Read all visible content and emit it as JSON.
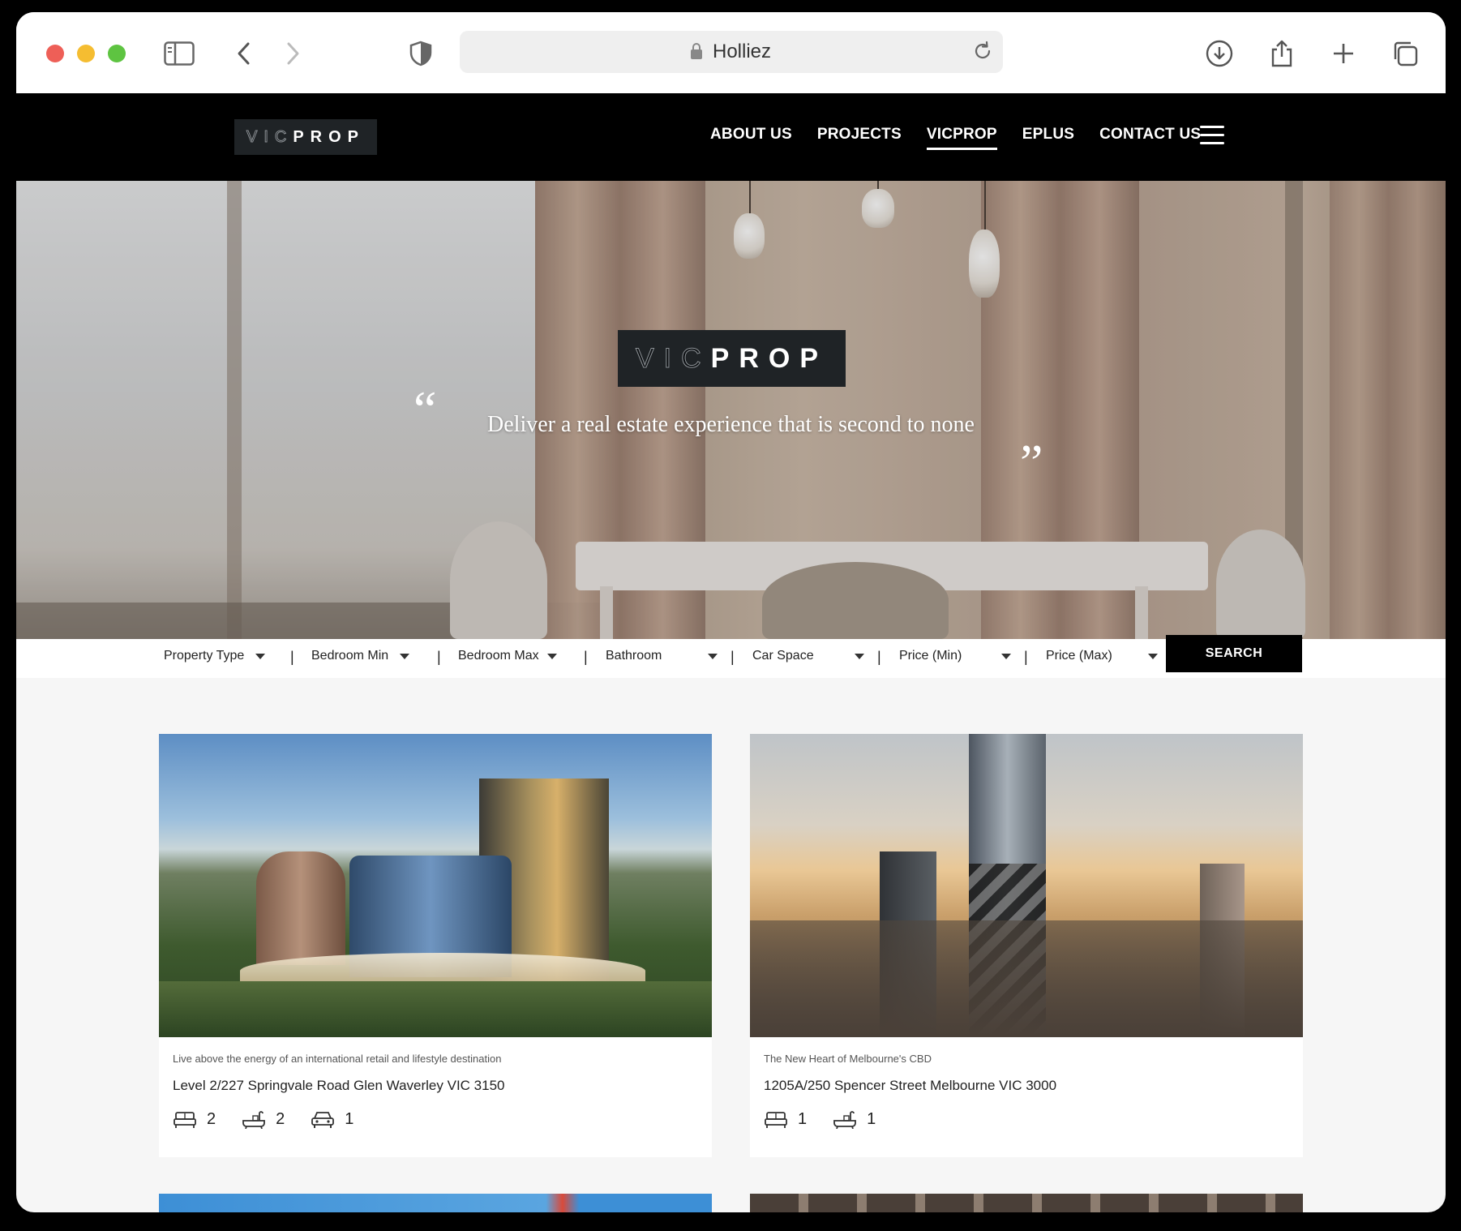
{
  "browser": {
    "url": "Holliez"
  },
  "header": {
    "logo": {
      "light": "VIC",
      "bold": "PROP"
    },
    "nav": [
      {
        "label": "ABOUT US"
      },
      {
        "label": "PROJECTS"
      },
      {
        "label": "VICPROP",
        "active": true
      },
      {
        "label": "EPLUS"
      },
      {
        "label": "CONTACT US"
      }
    ]
  },
  "hero": {
    "logo": {
      "light": "VIC",
      "bold": "PROP"
    },
    "quote_open": "“",
    "quote_close": "”",
    "tagline": "Deliver a real estate experience that is second to none"
  },
  "filters": {
    "items": [
      {
        "label": "Property Type"
      },
      {
        "label": "Bedroom Min"
      },
      {
        "label": "Bedroom Max"
      },
      {
        "label": "Bathroom"
      },
      {
        "label": "Car Space"
      },
      {
        "label": "Price (Min)"
      },
      {
        "label": "Price (Max)"
      }
    ],
    "separator": "|",
    "search_label": "SEARCH"
  },
  "listings": [
    {
      "description": "Live above the energy of an international retail and lifestyle destination",
      "address": "Level 2/227 Springvale Road Glen Waverley VIC 3150",
      "bedrooms": "2",
      "bathrooms": "2",
      "car_spaces": "1"
    },
    {
      "description": "The New Heart of Melbourne's CBD",
      "address": "1205A/250 Spencer Street Melbourne VIC 3000",
      "bedrooms": "1",
      "bathrooms": "1"
    }
  ],
  "colors": {
    "header_bg": "#000000",
    "logo_bg": "#1f2326",
    "search_bg": "#000000",
    "page_bg": "#f6f6f6"
  }
}
